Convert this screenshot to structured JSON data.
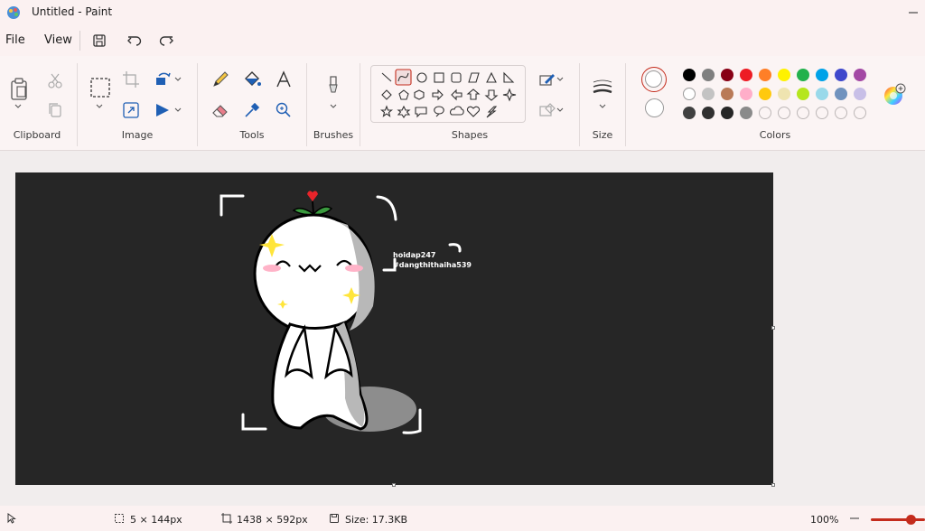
{
  "window": {
    "title": "Untitled - Paint"
  },
  "menu": {
    "file": "File",
    "view": "View"
  },
  "groups": {
    "clipboard": "Clipboard",
    "image": "Image",
    "tools": "Tools",
    "brushes": "Brushes",
    "shapes": "Shapes",
    "size": "Size",
    "colors": "Colors"
  },
  "canvas": {
    "watermark_line1": "hoidap247",
    "watermark_line2": "#dangthithaiha539"
  },
  "status": {
    "selection_size": "5 × 144px",
    "canvas_size": "1438 × 592px",
    "file_size": "Size: 17.3KB",
    "zoom": "100%"
  },
  "colors": {
    "row1": [
      "#000000",
      "#7f7f7f",
      "#880015",
      "#ed1c24",
      "#ff7f27",
      "#fff200",
      "#22b14c",
      "#00a2e8",
      "#3f48cc",
      "#a349a4"
    ],
    "row2": [
      "#ffffff",
      "#c3c3c3",
      "#b97a57",
      "#ffaec9",
      "#ffc90e",
      "#efe4b0",
      "#b5e61d",
      "#99d9ea",
      "#7092be",
      "#c8bfe7"
    ],
    "row3": [
      "#404040",
      "#303030",
      "#262626",
      "#8a8a8a",
      "empty",
      "empty",
      "empty",
      "empty",
      "empty",
      "empty"
    ],
    "primary": "#ffffff",
    "accent": "#c42b1c"
  }
}
